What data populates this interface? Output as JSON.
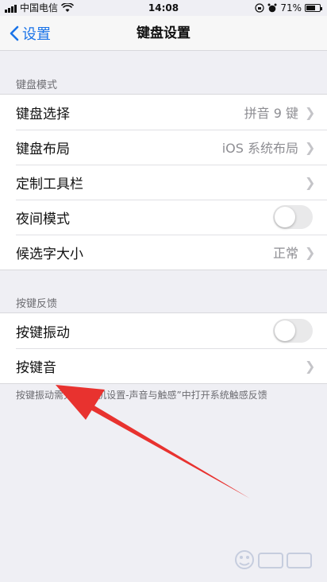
{
  "status_bar": {
    "carrier": "中国电信",
    "time": "14:08",
    "battery_percent": "71%",
    "battery_level": 0.71
  },
  "nav": {
    "back_label": "设置",
    "title": "键盘设置"
  },
  "sections": {
    "keyboard_mode": {
      "header": "键盘模式",
      "rows": [
        {
          "label": "键盘选择",
          "value": "拼音 9 键"
        },
        {
          "label": "键盘布局",
          "value": "iOS 系统布局"
        },
        {
          "label": "定制工具栏"
        },
        {
          "label": "夜间模式",
          "toggle": false
        },
        {
          "label": "候选字大小",
          "value": "正常"
        }
      ]
    },
    "key_feedback": {
      "header": "按键反馈",
      "rows": [
        {
          "label": "按键振动",
          "toggle": false
        },
        {
          "label": "按键音"
        }
      ]
    }
  },
  "footnote": "按键振动需先在“手机设置-声音与触感”中打开系统触感反馈",
  "annotation": {
    "arrow_color": "#e8322f"
  },
  "icons": {
    "wifi": "wifi-icon",
    "back": "chevron-left-icon",
    "chevron": "chevron-right-icon",
    "lock_rotation": "orientation-lock-icon",
    "alarm": "alarm-icon",
    "battery": "battery-icon"
  }
}
